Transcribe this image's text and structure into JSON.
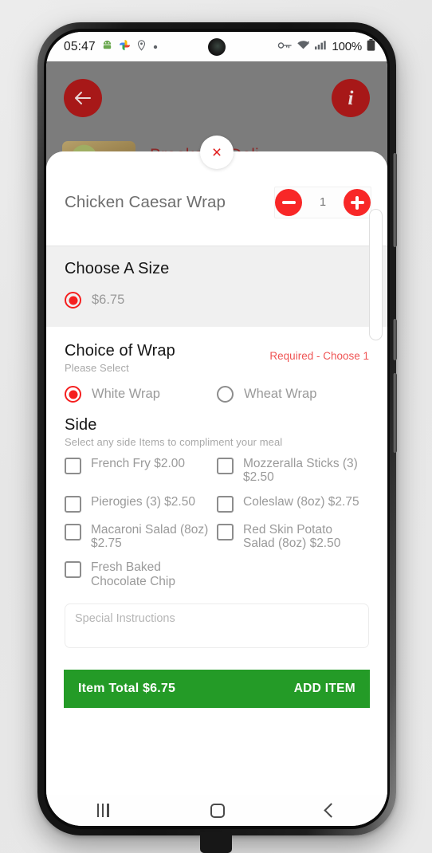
{
  "status_bar": {
    "time": "05:47",
    "icons_left": [
      "android-icon",
      "photos-icon",
      "location-icon",
      "dot-icon"
    ],
    "icons_right": [
      "vpn-key-icon",
      "wifi-icon",
      "signal-icon"
    ],
    "battery": "100%"
  },
  "app": {
    "back_button": "back-arrow",
    "info_button": "i",
    "store_name": "Brookside Deli"
  },
  "modal": {
    "close_label": "×",
    "item_title": "Chicken Caesar Wrap",
    "quantity": "1",
    "decrement_label": "minus",
    "increment_label": "plus",
    "sections": {
      "size": {
        "title": "Choose A Size",
        "options": [
          {
            "label": "$6.75",
            "selected": true
          }
        ]
      },
      "wrap": {
        "title": "Choice of Wrap",
        "subtitle": "Please Select",
        "required_note": "Required - Choose 1",
        "options": [
          {
            "label": "White Wrap",
            "selected": true
          },
          {
            "label": "Wheat Wrap",
            "selected": false
          }
        ]
      },
      "side": {
        "title": "Side",
        "subtitle": "Select any side Items to compliment your meal",
        "options": [
          {
            "label": "French Fry $2.00",
            "checked": false
          },
          {
            "label": "Mozzeralla Sticks (3) $2.50",
            "checked": false
          },
          {
            "label": "Pierogies (3) $2.50",
            "checked": false
          },
          {
            "label": "Coleslaw (8oz) $2.75",
            "checked": false
          },
          {
            "label": "Macaroni Salad (8oz) $2.75",
            "checked": false
          },
          {
            "label": "Red Skin Potato Salad (8oz) $2.50",
            "checked": false
          },
          {
            "label": "Fresh Baked Chocolate Chip",
            "checked": false
          }
        ]
      }
    },
    "special_instructions": {
      "placeholder": "Special Instructions",
      "value": ""
    },
    "add_bar": {
      "total_label": "Item Total $6.75",
      "cta_label": "ADD ITEM"
    }
  },
  "nav_bar": {
    "recents": "recents-icon",
    "home": "home-icon",
    "back": "back-icon"
  },
  "colors": {
    "accent_red": "#f51f1f",
    "brand_dark_red": "#a71818",
    "required_red": "#ef5454",
    "add_green": "#249b27",
    "section_gray": "#f0f0f0"
  }
}
